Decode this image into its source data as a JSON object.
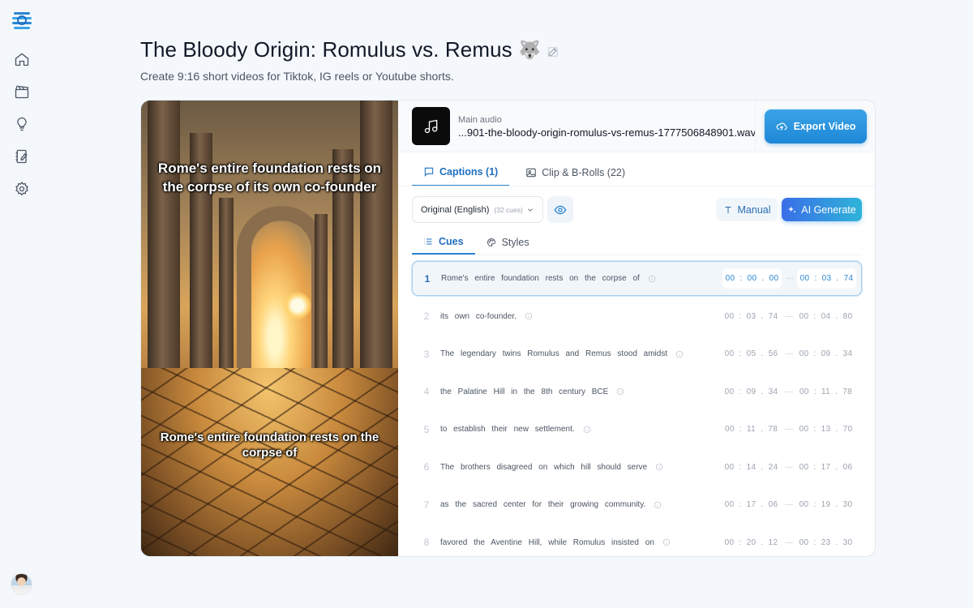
{
  "header": {
    "title": "The Bloody Origin: Romulus vs. Remus",
    "title_emoji": "🐺",
    "subtitle": "Create 9:16 short videos for Tiktok, IG reels or Youtube shorts."
  },
  "sidebar": {
    "items": [
      {
        "icon": "home-icon"
      },
      {
        "icon": "clapperboard-icon"
      },
      {
        "icon": "lightbulb-icon"
      },
      {
        "icon": "notebook-edit-icon"
      },
      {
        "icon": "gear-icon"
      }
    ]
  },
  "preview": {
    "caption_top": "Rome's entire foundation rests on the corpse of its own co-founder",
    "caption_bottom": "Rome's entire foundation rests on the corpse of"
  },
  "audio": {
    "label": "Main audio",
    "filename": "...901-the-bloody-origin-romulus-vs-remus-1777506848901.wav"
  },
  "export_label": "Export Video",
  "tabs": [
    {
      "label": "Captions (1)",
      "active": true
    },
    {
      "label": "Clip & B-Rolls (22)",
      "active": false
    }
  ],
  "controls": {
    "language": "Original (English)",
    "cue_count": "(32 cues)",
    "manual_label": "Manual",
    "ai_label": "AI Generate"
  },
  "subtabs": [
    {
      "label": "Cues",
      "active": true
    },
    {
      "label": "Styles",
      "active": false
    }
  ],
  "cues": [
    {
      "num": "1",
      "text": "Rome's entire foundation rests on the corpse of",
      "start": "00 : 00 . 00",
      "end": "00 : 03 . 74",
      "active": true
    },
    {
      "num": "2",
      "text": "its own co-founder.",
      "start": "00 : 03 . 74",
      "end": "00 : 04 . 80"
    },
    {
      "num": "3",
      "text": "The legendary twins Romulus and Remus stood amidst",
      "start": "00 : 05 . 56",
      "end": "00 : 09 . 34"
    },
    {
      "num": "4",
      "text": "the Palatine Hill in the 8th century BCE",
      "start": "00 : 09 . 34",
      "end": "00 : 11 . 78"
    },
    {
      "num": "5",
      "text": "to establish their new settlement.",
      "start": "00 : 11 . 78",
      "end": "00 : 13 . 70"
    },
    {
      "num": "6",
      "text": "The brothers disagreed on which hill should serve",
      "start": "00 : 14 . 24",
      "end": "00 : 17 . 06"
    },
    {
      "num": "7",
      "text": "as the sacred center for their growing community.",
      "start": "00 : 17 . 06",
      "end": "00 : 19 . 30"
    },
    {
      "num": "8",
      "text": "favored the Aventine Hill, while Romulus insisted on",
      "start": "00 : 20 . 12",
      "end": "00 : 23 . 30"
    }
  ],
  "time_separator": "—",
  "colors": {
    "accent": "#2b86d2",
    "export_bg": "#1e88d8",
    "ai_gradient_start": "#3a6ee8",
    "ai_gradient_end": "#2fb4d8",
    "page_bg": "#f4f8fc"
  }
}
